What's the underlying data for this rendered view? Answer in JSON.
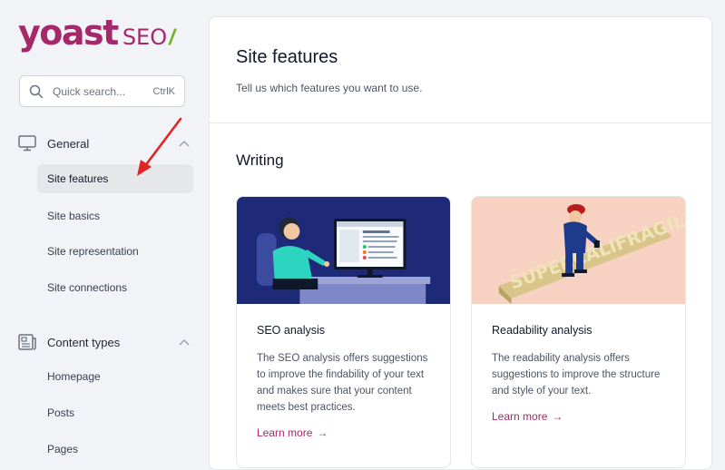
{
  "logo": {
    "word": "yoast",
    "product": "SEO",
    "slash": "/"
  },
  "search": {
    "placeholder": "Quick search...",
    "shortcut": "CtrlK"
  },
  "sidebar": {
    "groups": [
      {
        "label": "General",
        "icon": "desktop-icon",
        "items": [
          {
            "label": "Site features",
            "active": true
          },
          {
            "label": "Site basics"
          },
          {
            "label": "Site representation"
          },
          {
            "label": "Site connections"
          }
        ]
      },
      {
        "label": "Content types",
        "icon": "newspaper-icon",
        "items": [
          {
            "label": "Homepage"
          },
          {
            "label": "Posts"
          },
          {
            "label": "Pages"
          }
        ]
      }
    ]
  },
  "main": {
    "title": "Site features",
    "subtitle": "Tell us which features you want to use.",
    "section": "Writing",
    "cards": [
      {
        "title": "SEO analysis",
        "description": "The SEO analysis offers suggestions to improve the findability of your text and makes sure that your content meets best practices.",
        "link": "Learn more",
        "link_arrow": "→"
      },
      {
        "title": "Readability analysis",
        "description": "The readability analysis offers suggestions to improve the structure and style of your text.",
        "link": "Learn more",
        "link_arrow": "→",
        "illustration_text": "SUPERCALIFRAGILISTIC"
      }
    ]
  },
  "colors": {
    "brand": "#a4286a",
    "accent_green": "#77b227",
    "annotation_arrow": "#e02424",
    "card1_bg": "#1e2a78",
    "card2_bg": "#f7d1c1"
  }
}
